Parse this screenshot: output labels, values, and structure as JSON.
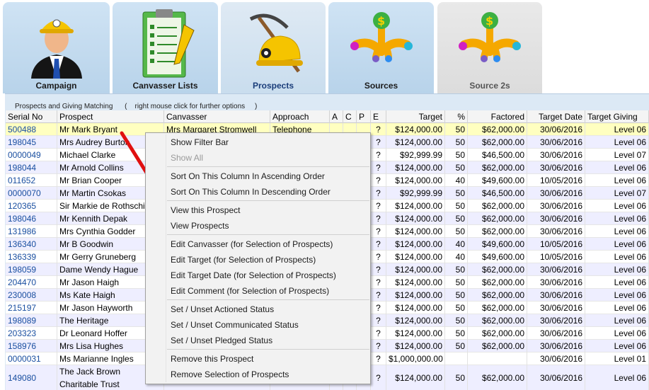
{
  "tabs": [
    {
      "label": "Campaign",
      "icon": "miner-person-icon"
    },
    {
      "label": "Canvasser Lists",
      "icon": "clipboard-checklist-icon"
    },
    {
      "label": "Prospects",
      "icon": "pickaxe-helmet-icon"
    },
    {
      "label": "Sources",
      "icon": "money-tree-icon"
    },
    {
      "label": "Source 2s",
      "icon": "money-tree-icon"
    }
  ],
  "caption": "Prospects and Giving Matching      (    right mouse click for further options     )",
  "grid": {
    "columns": [
      "Serial No",
      "Prospect",
      "Canvasser",
      "Approach",
      "A",
      "C",
      "P",
      "E",
      "Target",
      "%",
      "Factored",
      "Target Date",
      "Target Giving"
    ],
    "rows": [
      {
        "serial": "500488",
        "prospect": "Mr Mark Bryant",
        "canvasser": "Mrs Margaret Stromwell",
        "approach": "Telephone",
        "e": "?",
        "target": "$124,000.00",
        "pct": "50",
        "factored": "$62,000.00",
        "date": "30/06/2016",
        "giving": "Level 06"
      },
      {
        "serial": "198045",
        "prospect": "Mrs Audrey Burton",
        "canvasser": "",
        "approach": "",
        "e": "?",
        "target": "$124,000.00",
        "pct": "50",
        "factored": "$62,000.00",
        "date": "30/06/2016",
        "giving": "Level 06"
      },
      {
        "serial": "0000049",
        "prospect": " Michael Clarke",
        "canvasser": "",
        "approach": "",
        "e": "?",
        "target": "$92,999.99",
        "pct": "50",
        "factored": "$46,500.00",
        "date": "30/06/2016",
        "giving": "Level 07"
      },
      {
        "serial": "198044",
        "prospect": "Mr Arnold Collins",
        "canvasser": "",
        "approach": "",
        "e": "?",
        "target": "$124,000.00",
        "pct": "50",
        "factored": "$62,000.00",
        "date": "30/06/2016",
        "giving": "Level 06"
      },
      {
        "serial": "011652",
        "prospect": "Mr Brian Cooper",
        "canvasser": "",
        "approach": "",
        "e": "?",
        "target": "$124,000.00",
        "pct": "40",
        "factored": "$49,600.00",
        "date": "10/05/2016",
        "giving": "Level 06"
      },
      {
        "serial": "0000070",
        "prospect": "Mr Martin Csokas",
        "canvasser": "",
        "approach": "",
        "e": "?",
        "target": "$92,999.99",
        "pct": "50",
        "factored": "$46,500.00",
        "date": "30/06/2016",
        "giving": "Level 07"
      },
      {
        "serial": "120365",
        "prospect": "Sir Markie de Rothschild",
        "canvasser": "",
        "approach": "",
        "e": "?",
        "target": "$124,000.00",
        "pct": "50",
        "factored": "$62,000.00",
        "date": "30/06/2016",
        "giving": "Level 06"
      },
      {
        "serial": "198046",
        "prospect": "Mr Kennith Depak",
        "canvasser": "",
        "approach": "",
        "e": "?",
        "target": "$124,000.00",
        "pct": "50",
        "factored": "$62,000.00",
        "date": "30/06/2016",
        "giving": "Level 06"
      },
      {
        "serial": "131986",
        "prospect": "Mrs Cynthia Godder",
        "canvasser": "",
        "approach": "",
        "e": "?",
        "target": "$124,000.00",
        "pct": "50",
        "factored": "$62,000.00",
        "date": "30/06/2016",
        "giving": "Level 06"
      },
      {
        "serial": "136340",
        "prospect": "Mr B Goodwin",
        "canvasser": "",
        "approach": "",
        "e": "?",
        "target": "$124,000.00",
        "pct": "40",
        "factored": "$49,600.00",
        "date": "10/05/2016",
        "giving": "Level 06"
      },
      {
        "serial": "136339",
        "prospect": "Mr Gerry Gruneberg",
        "canvasser": "",
        "approach": "",
        "e": "?",
        "target": "$124,000.00",
        "pct": "40",
        "factored": "$49,600.00",
        "date": "10/05/2016",
        "giving": "Level 06"
      },
      {
        "serial": "198059",
        "prospect": "Dame Wendy Hague",
        "canvasser": "",
        "approach": "",
        "e": "?",
        "target": "$124,000.00",
        "pct": "50",
        "factored": "$62,000.00",
        "date": "30/06/2016",
        "giving": "Level 06"
      },
      {
        "serial": "204470",
        "prospect": "Mr Jason Haigh",
        "canvasser": "",
        "approach": "",
        "e": "?",
        "target": "$124,000.00",
        "pct": "50",
        "factored": "$62,000.00",
        "date": "30/06/2016",
        "giving": "Level 06"
      },
      {
        "serial": "230008",
        "prospect": "Ms Kate Haigh",
        "canvasser": "",
        "approach": "",
        "e": "?",
        "target": "$124,000.00",
        "pct": "50",
        "factored": "$62,000.00",
        "date": "30/06/2016",
        "giving": "Level 06"
      },
      {
        "serial": "215197",
        "prospect": "Mr Jason Hayworth",
        "canvasser": "",
        "approach": "",
        "e": "?",
        "target": "$124,000.00",
        "pct": "50",
        "factored": "$62,000.00",
        "date": "30/06/2016",
        "giving": "Level 06"
      },
      {
        "serial": "198089",
        "prospect": "The  Heritage",
        "canvasser": "",
        "approach": "",
        "e": "?",
        "target": "$124,000.00",
        "pct": "50",
        "factored": "$62,000.00",
        "date": "30/06/2016",
        "giving": "Level 06"
      },
      {
        "serial": "203323",
        "prospect": "Dr Leonard Hoffer",
        "canvasser": "",
        "approach": "",
        "e": "?",
        "target": "$124,000.00",
        "pct": "50",
        "factored": "$62,000.00",
        "date": "30/06/2016",
        "giving": "Level 06"
      },
      {
        "serial": "158976",
        "prospect": "Mrs Lisa Hughes",
        "canvasser": "",
        "approach": "",
        "e": "?",
        "target": "$124,000.00",
        "pct": "50",
        "factored": "$62,000.00",
        "date": "30/06/2016",
        "giving": "Level 06"
      },
      {
        "serial": "0000031",
        "prospect": "Ms Marianne Ingles",
        "canvasser": "",
        "approach": "",
        "e": "?",
        "target": "$1,000,000.00",
        "pct": "",
        "factored": "",
        "date": "30/06/2016",
        "giving": "Level 01"
      },
      {
        "serial": "149080",
        "prospect": "The  Jack Brown Charitable Trust",
        "canvasser": "",
        "approach": "",
        "e": "?",
        "target": "$124,000.00",
        "pct": "50",
        "factored": "$62,000.00",
        "date": "30/06/2016",
        "giving": "Level 06"
      }
    ]
  },
  "context_menu": {
    "groups": [
      [
        {
          "label": "Show Filter Bar",
          "enabled": true
        },
        {
          "label": "Show All",
          "enabled": false
        }
      ],
      [
        {
          "label": "Sort On This Column In Ascending Order",
          "enabled": true
        },
        {
          "label": "Sort On This Column In Descending Order",
          "enabled": true
        }
      ],
      [
        {
          "label": "View this Prospect",
          "enabled": true
        },
        {
          "label": "View Prospects",
          "enabled": true
        }
      ],
      [
        {
          "label": "Edit Canvasser (for Selection of Prospects)",
          "enabled": true
        },
        {
          "label": "Edit Target (for Selection of Prospects)",
          "enabled": true
        },
        {
          "label": "Edit Target Date (for Selection of Prospects)",
          "enabled": true
        },
        {
          "label": "Edit Comment (for Selection of Prospects)",
          "enabled": true
        }
      ],
      [
        {
          "label": "Set / Unset Actioned Status",
          "enabled": true
        },
        {
          "label": "Set / Unset Communicated Status",
          "enabled": true
        },
        {
          "label": "Set / Unset Pledged Status",
          "enabled": true
        }
      ],
      [
        {
          "label": "Remove this Prospect",
          "enabled": true
        },
        {
          "label": "Remove Selection of Prospects",
          "enabled": true
        }
      ]
    ]
  },
  "colors": {
    "selected_row": "#ffffc0",
    "alt_row": "#eeeeff",
    "tab": "#c3dbef",
    "arrow": "#e01010"
  }
}
